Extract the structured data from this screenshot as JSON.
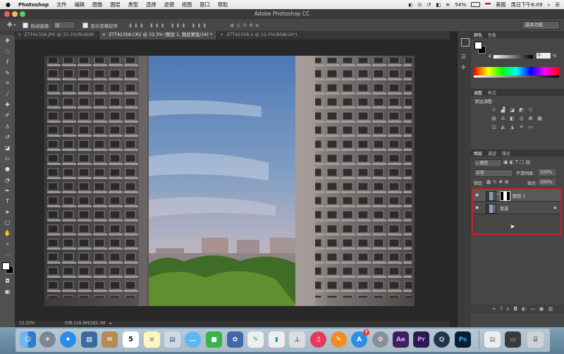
{
  "menubar": {
    "apple": "",
    "app_name": "Photoshop",
    "items": [
      "文件",
      "编辑",
      "图像",
      "图层",
      "类型",
      "选择",
      "滤镜",
      "视图",
      "窗口",
      "帮助"
    ],
    "battery": "54%",
    "input_method": "美国",
    "clock": "周日下午6:09"
  },
  "title": {
    "text": "Adobe Photoshop CC"
  },
  "options": {
    "auto_select_label": "自动选择:",
    "auto_select_value": "组",
    "transform_controls_label": "显示变换控件",
    "workspace": "基本功能"
  },
  "tabs": [
    {
      "label": "ZTT42358.JPG @ 33.3%(RGB/8)"
    },
    {
      "label": "ZTT42358.CR2 @ 33.3% (图层 1, 图层蒙版/16) *"
    },
    {
      "label": "ZTT42358-2 @ 33.3%(RGB/16*)"
    }
  ],
  "status": {
    "zoom": "33.33%",
    "doc": "文档:126.8M/285.3M"
  },
  "color_panel": {
    "tabs": [
      "颜色",
      "色板"
    ],
    "k_label": "K",
    "k_value": "0",
    "percent": "%"
  },
  "adjust_panel": {
    "tabs": [
      "调整",
      "样式"
    ],
    "add_label": "添加调整"
  },
  "layers_panel": {
    "tabs": [
      "图层",
      "通道",
      "路径"
    ],
    "kind_filter": "类型",
    "blend_mode": "正常",
    "opacity_label": "不透明度:",
    "opacity_value": "100%",
    "lock_label": "锁定:",
    "fill_label": "填充:",
    "fill_value": "100%",
    "layers": [
      {
        "name": "图层 1"
      },
      {
        "name": "背景"
      }
    ]
  },
  "dock": {
    "calendar_day": "5",
    "appstore_badge": "7",
    "ae": "Ae",
    "pr": "Pr",
    "ps": "Ps"
  },
  "colors": {
    "highlight": "#d61d1d",
    "ps_blue": "#31a8ff",
    "ae_purple": "#3b1f5e",
    "pr_purple": "#2b1a4d"
  }
}
